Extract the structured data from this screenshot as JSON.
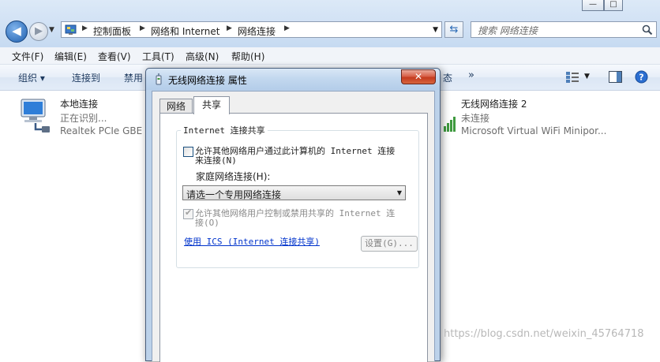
{
  "explorer": {
    "window_buttons": [
      "—",
      "□"
    ],
    "breadcrumbs": [
      "控制面板",
      "网络和 Internet",
      "网络连接"
    ],
    "search": {
      "placeholder": "搜索 网络连接"
    },
    "menu": [
      "文件(F)",
      "编辑(E)",
      "查看(V)",
      "工具(T)",
      "高级(N)",
      "帮助(H)"
    ],
    "toolbar": {
      "organize": "组织 ▾",
      "connect": "连接到",
      "disable": "禁用",
      "status_tail": "态",
      "more": "»"
    },
    "items": [
      {
        "title": "本地连接",
        "status": "正在识别...",
        "device": "Realtek PCIe GBE"
      },
      {
        "title": "无线网络连接 2",
        "status": "未连接",
        "device": "Microsoft Virtual WiFi Minipor..."
      }
    ]
  },
  "dialog": {
    "title": "无线网络连接 属性",
    "close": "✕",
    "tabs": [
      "网络",
      "共享"
    ],
    "group_title": "Internet 连接共享",
    "allow_share_line1": "允许其他网络用户通过此计算机的 Internet 连接",
    "allow_share_line2": "来连接(N)",
    "home_label": "家庭网络连接(H):",
    "home_value": "请选一个专用网络连接",
    "allow_control_line1": "允许其他网络用户控制或禁用共享的 Internet 连",
    "allow_control_line2": "接(O)",
    "ics_link": "使用 ICS (Internet 连接共享)",
    "settings_button": "设置(G)..."
  },
  "watermark": "https://blog.csdn.net/weixin_45764718",
  "colors": {
    "accent": "#1f5fae",
    "link": "#0033cc",
    "close": "#c43b1f"
  }
}
